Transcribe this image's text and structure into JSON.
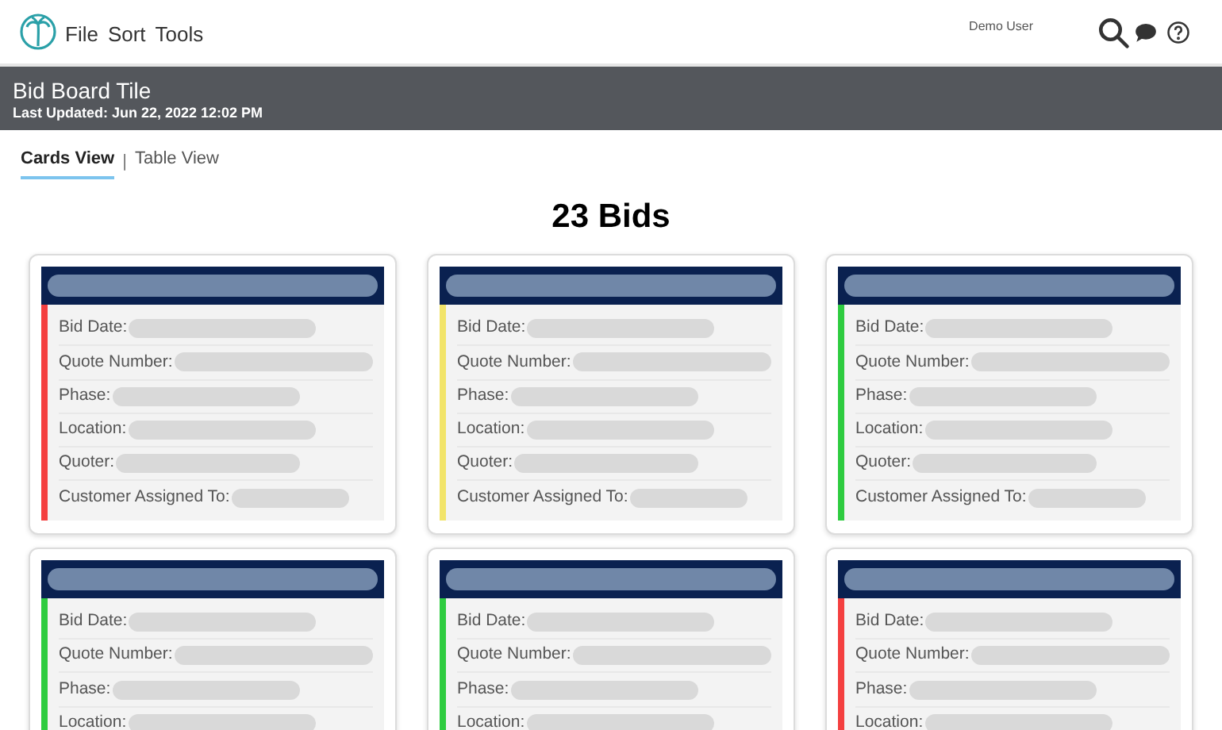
{
  "menu": [
    "File",
    "Sort",
    "Tools"
  ],
  "user": "Demo User",
  "header": {
    "title": "Bid Board Tile",
    "subtitle": "Last Updated: Jun 22, 2022 12:02 PM"
  },
  "tabs": [
    {
      "label": "Cards View",
      "selected": true
    },
    {
      "label": "Table View",
      "selected": false
    }
  ],
  "separator": "|",
  "count": "23 Bids",
  "cards": [
    {
      "color": "#f44040",
      "fields": [
        "Bid Date:",
        "Quote Number:",
        "Phase:",
        "Location:",
        "Quoter:",
        "Customer Assigned To:"
      ]
    },
    {
      "color": "#f2e46a",
      "fields": [
        "Bid Date:",
        "Quote Number:",
        "Phase:",
        "Location:",
        "Quoter:",
        "Customer Assigned To:"
      ]
    },
    {
      "color": "#2ecc40",
      "fields": [
        "Bid Date:",
        "Quote Number:",
        "Phase:",
        "Location:",
        "Quoter:",
        "Customer Assigned To:"
      ]
    },
    {
      "color": "#2ecc40",
      "fields": [
        "Bid Date:",
        "Quote Number:",
        "Phase:",
        "Location:"
      ]
    },
    {
      "color": "#2ecc40",
      "fields": [
        "Bid Date:",
        "Quote Number:",
        "Phase:",
        "Location:"
      ]
    },
    {
      "color": "#f44040",
      "fields": [
        "Bid Date:",
        "Quote Number:",
        "Phase:",
        "Location:"
      ]
    }
  ]
}
